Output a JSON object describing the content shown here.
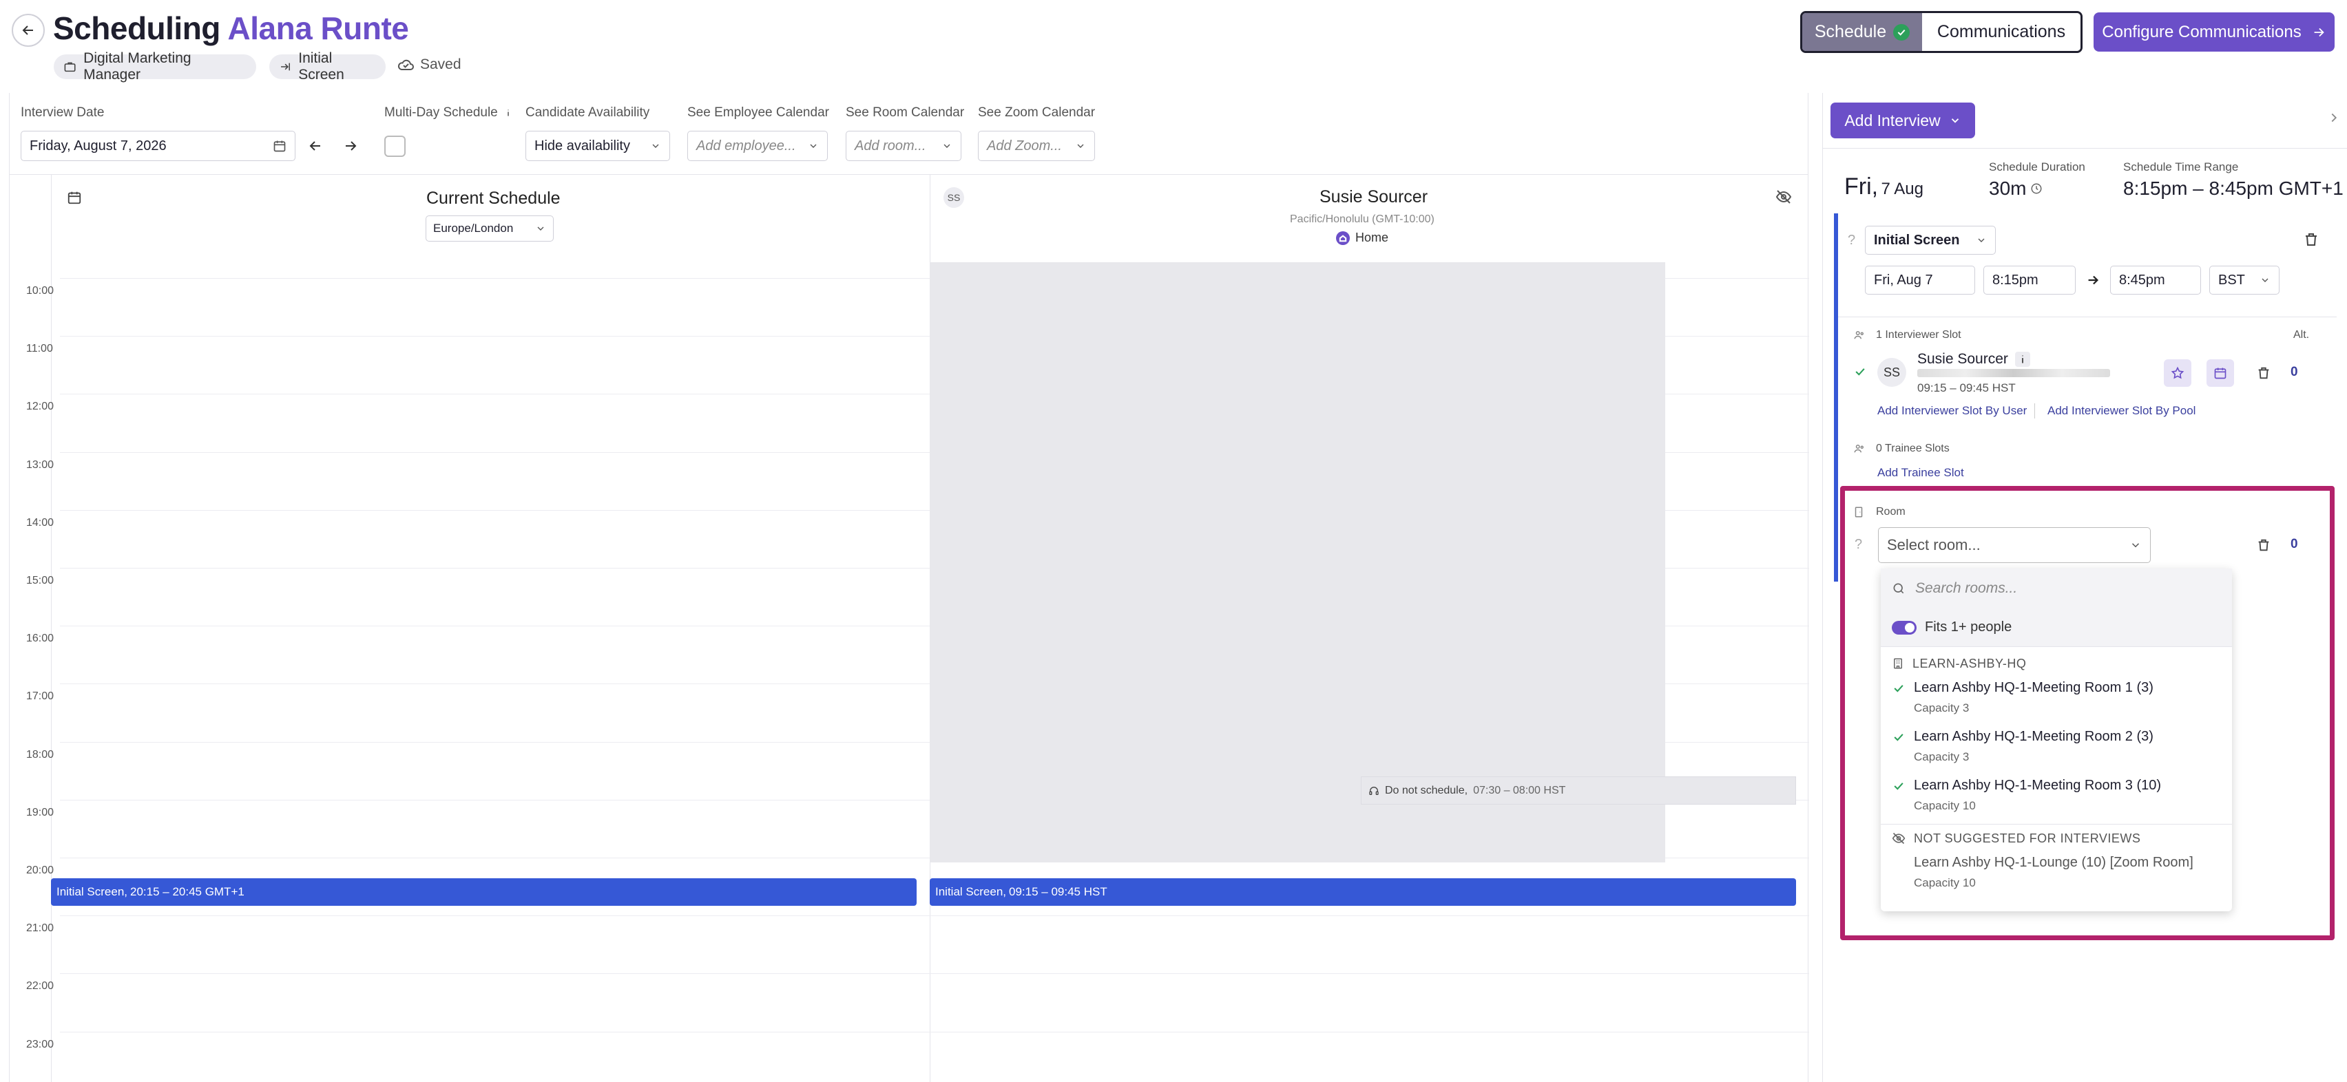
{
  "header": {
    "title_prefix": "Scheduling",
    "candidate_name": "Alana Runte",
    "job_chip": "Digital Marketing Manager",
    "stage_chip": "Initial Screen",
    "saved_label": "Saved"
  },
  "segmented": {
    "schedule_label": "Schedule",
    "communications_label": "Communications"
  },
  "configure_button": "Configure Communications",
  "filters": {
    "interview_date_label": "Interview Date",
    "interview_date_value": "Friday, August 7, 2026",
    "multi_day_label": "Multi-Day Schedule",
    "candidate_availability_label": "Candidate Availability",
    "candidate_availability_value": "Hide availability",
    "employee_calendar_label": "See Employee Calendar",
    "employee_calendar_placeholder": "Add employee...",
    "room_calendar_label": "See Room Calendar",
    "room_calendar_placeholder": "Add room...",
    "zoom_calendar_label": "See Zoom Calendar",
    "zoom_calendar_placeholder": "Add Zoom..."
  },
  "calendar": {
    "hours": [
      "10:00",
      "11:00",
      "12:00",
      "13:00",
      "14:00",
      "15:00",
      "16:00",
      "17:00",
      "18:00",
      "19:00",
      "20:00",
      "21:00",
      "22:00",
      "23:00"
    ],
    "current_schedule_title": "Current Schedule",
    "current_timezone": "Europe/London",
    "person_initials": "SS",
    "person_name": "Susie Sourcer",
    "person_timezone": "Pacific/Honolulu (GMT-10:00)",
    "person_location": "Home",
    "do_not_schedule_label": "Do not schedule,",
    "do_not_schedule_time": "07:30 – 08:00 HST",
    "event_left_title": "Initial Screen,",
    "event_left_time": "20:15 – 20:45 GMT+1",
    "event_right_title": "Initial Screen,",
    "event_right_time": "09:15 – 09:45 HST"
  },
  "panel": {
    "add_interview": "Add Interview",
    "day_label": "Fri,",
    "date_label": "7 Aug",
    "duration_label": "Schedule Duration",
    "duration_value": "30m",
    "time_range_label": "Schedule Time Range",
    "time_range_value": "8:15pm – 8:45pm GMT+1",
    "interview_type": "Initial Screen",
    "date_input": "Fri, Aug 7",
    "start_time": "8:15pm",
    "end_time": "8:45pm",
    "timezone": "BST",
    "interviewer_slot_label": "1 Interviewer Slot",
    "alt_label": "Alt.",
    "interviewer_initials": "SS",
    "interviewer_name": "Susie Sourcer",
    "interviewer_time": "09:15 – 09:45 HST",
    "interviewer_count": "0",
    "add_slot_user": "Add Interviewer Slot By User",
    "add_slot_pool": "Add Interviewer Slot By Pool",
    "trainee_label": "0 Trainee Slots",
    "add_trainee": "Add Trainee Slot",
    "room_label": "Room",
    "room_placeholder": "Select room...",
    "room_count": "0"
  },
  "dropdown": {
    "search_placeholder": "Search rooms...",
    "fits_label": "Fits 1+ people",
    "group1": "LEARN-ASHBY-HQ",
    "items": [
      {
        "name": "Learn Ashby HQ-1-Meeting Room 1 (3)",
        "capacity": "Capacity 3"
      },
      {
        "name": "Learn Ashby HQ-1-Meeting Room 2 (3)",
        "capacity": "Capacity 3"
      },
      {
        "name": "Learn Ashby HQ-1-Meeting Room 3 (10)",
        "capacity": "Capacity 10"
      }
    ],
    "group2": "NOT SUGGESTED FOR INTERVIEWS",
    "other_item": {
      "name": "Learn Ashby HQ-1-Lounge (10) [Zoom Room]",
      "capacity": "Capacity 10"
    }
  },
  "colors": {
    "accent": "#6b4fc8",
    "event": "#3658d6",
    "highlight": "#b3226b",
    "success": "#2ca05a"
  }
}
